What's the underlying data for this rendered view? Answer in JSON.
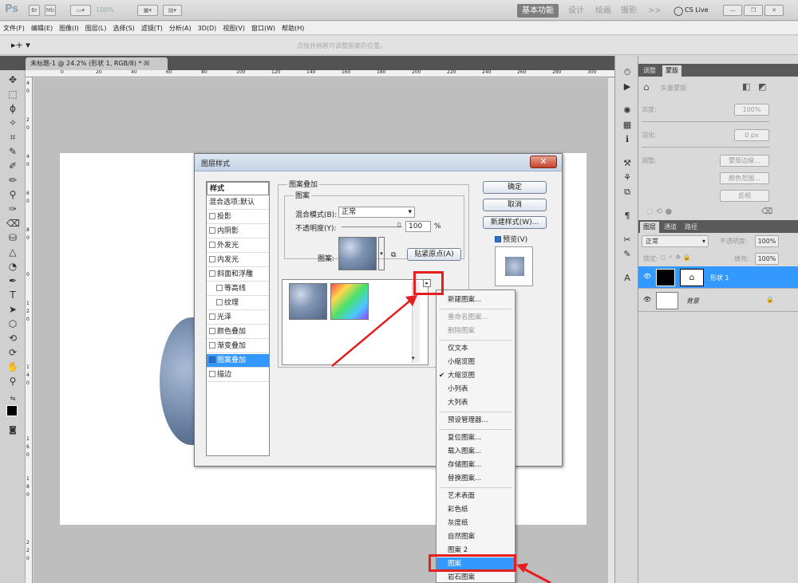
{
  "app": {
    "logo": "Ps",
    "top_tools": [
      "Br",
      "Mb"
    ],
    "zoom": "100%",
    "hint": "点按并拖移可调整图案的位置。"
  },
  "workspace": {
    "items": [
      "基本功能",
      "设计",
      "绘画",
      "摄影",
      ">>"
    ],
    "active": 0,
    "cslive": "CS Live"
  },
  "menu": [
    "文件(F)",
    "编辑(E)",
    "图像(I)",
    "图层(L)",
    "选择(S)",
    "滤镜(T)",
    "分析(A)",
    "3D(D)",
    "视图(V)",
    "窗口(W)",
    "帮助(H)"
  ],
  "doc_tab": "未标题-1 @ 24.2% (形状 1, RGB/8) *",
  "ruler_top": [
    "0",
    "20",
    "40",
    "60",
    "80",
    "100",
    "120",
    "140",
    "160",
    "180",
    "200",
    "220",
    "240",
    "260",
    "280",
    "300"
  ],
  "ruler_left": [
    "4",
    "0",
    "2",
    "0",
    "4",
    "0",
    "6",
    "0",
    "8",
    "0",
    "0",
    "1",
    "2",
    "0",
    "1",
    "4",
    "0",
    "1",
    "6",
    "0",
    "1",
    "8",
    "0",
    "2",
    "2",
    "0"
  ],
  "mask_panel": {
    "tabs": [
      "调整",
      "蒙版"
    ],
    "mode": "矢量蒙版",
    "density_label": "浓度:",
    "density": "100%",
    "feather_label": "羽化:",
    "feather": "0 px",
    "refine_label": "调整:",
    "buttons": [
      "蒙版边缘...",
      "颜色范围...",
      "反相"
    ]
  },
  "layers_panel": {
    "tabs": [
      "图层",
      "通道",
      "路径"
    ],
    "blend": "正常",
    "opacity_label": "不透明度:",
    "opacity": "100%",
    "lock_label": "锁定:",
    "fill_label": "填充:",
    "fill": "100%",
    "layers": [
      {
        "name": "形状 1",
        "selected": true
      },
      {
        "name": "背景",
        "selected": false
      }
    ]
  },
  "dialog": {
    "title": "图层样式",
    "styles": [
      {
        "label": "样式",
        "cb": null
      },
      {
        "label": "混合选项:默认",
        "cb": null
      },
      {
        "label": "投影",
        "cb": false
      },
      {
        "label": "内阴影",
        "cb": false
      },
      {
        "label": "外发光",
        "cb": false
      },
      {
        "label": "内发光",
        "cb": false
      },
      {
        "label": "斜面和浮雕",
        "cb": false
      },
      {
        "label": "等高线",
        "cb": false
      },
      {
        "label": "纹理",
        "cb": false
      },
      {
        "label": "光泽",
        "cb": false
      },
      {
        "label": "颜色叠加",
        "cb": false
      },
      {
        "label": "渐变叠加",
        "cb": false
      },
      {
        "label": "图案叠加",
        "cb": true
      },
      {
        "label": "描边",
        "cb": false
      }
    ],
    "selected_style": 12,
    "section_title": "图案叠加",
    "sub_title": "图案",
    "blend_label": "混合模式(B):",
    "blend_value": "正常",
    "opacity_label": "不透明度(Y):",
    "opacity_value": "100",
    "opacity_unit": "%",
    "pattern_label": "图案:",
    "snap_button": "贴紧原点(A)",
    "ok": "确定",
    "cancel": "取消",
    "new_style": "新建样式(W)...",
    "preview_label": "预览(V)",
    "preview_checked": true
  },
  "context_menu": {
    "items": [
      {
        "label": "新建图案...",
        "state": "normal"
      },
      {
        "sep": true
      },
      {
        "label": "重命名图案...",
        "state": "disabled"
      },
      {
        "label": "删除图案",
        "state": "disabled"
      },
      {
        "sep": true
      },
      {
        "label": "仅文本",
        "state": "normal"
      },
      {
        "label": "小缩览图",
        "state": "normal"
      },
      {
        "label": "大缩览图",
        "state": "checked"
      },
      {
        "label": "小列表",
        "state": "normal"
      },
      {
        "label": "大列表",
        "state": "normal"
      },
      {
        "sep": true
      },
      {
        "label": "预设管理器...",
        "state": "normal"
      },
      {
        "sep": true
      },
      {
        "label": "复位图案...",
        "state": "normal"
      },
      {
        "label": "载入图案...",
        "state": "normal"
      },
      {
        "label": "存储图案...",
        "state": "normal"
      },
      {
        "label": "替换图案...",
        "state": "normal"
      },
      {
        "sep": true
      },
      {
        "label": "艺术表面",
        "state": "normal"
      },
      {
        "label": "彩色纸",
        "state": "normal"
      },
      {
        "label": "灰度纸",
        "state": "normal"
      },
      {
        "label": "自然图案",
        "state": "normal"
      },
      {
        "label": "图案 2",
        "state": "normal"
      },
      {
        "label": "图案",
        "state": "highlighted"
      },
      {
        "label": "岩石图案",
        "state": "normal"
      }
    ]
  }
}
